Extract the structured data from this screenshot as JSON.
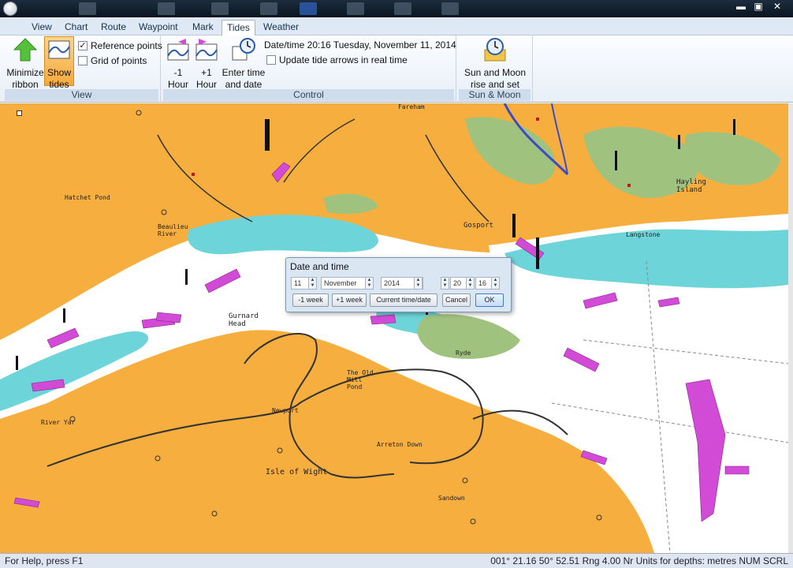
{
  "window": {
    "title": ""
  },
  "menu": {
    "tabs": [
      {
        "label": "View"
      },
      {
        "label": "Chart"
      },
      {
        "label": "Route"
      },
      {
        "label": "Waypoint"
      },
      {
        "label": "Mark"
      },
      {
        "label": "Tides"
      },
      {
        "label": "Weather"
      }
    ],
    "active_tab": "Tides"
  },
  "ribbon": {
    "view_group": {
      "label": "View",
      "minimize_label": "Minimize ribbon",
      "show_tides_label": "Show tides",
      "reference_points_label": "Reference points",
      "reference_points_checked": "✓",
      "grid_of_points_label": "Grid of points"
    },
    "control_group": {
      "label": "Control",
      "minus_hour_label": "-1 Hour",
      "plus_hour_label": "+1 Hour",
      "enter_time_label": "Enter time and date",
      "datetime_text": "Date/time 20:16 Tuesday, November 11, 2014",
      "update_arrows_label": "Update tide arrows in real time"
    },
    "sun_moon_group": {
      "label": "Sun & Moon",
      "button_label": "Sun and Moon rise and set times"
    }
  },
  "dialog": {
    "title": "Date and time",
    "day": "11",
    "month": "November",
    "year": "2014",
    "hour": "20",
    "minute": "16",
    "minus_week": "-1 week",
    "plus_week": "+1 week",
    "current_time": "Current time/date",
    "cancel": "Cancel",
    "ok": "OK"
  },
  "map": {
    "labels": {
      "fareham": "Fareham",
      "gosport": "Gosport",
      "gurnard_head": "Gurnard Head",
      "isle_of_wight": "Isle of Wight",
      "hayling_island": "Hayling Island",
      "river_yar": "River Yar",
      "beaulieu_river": "Beaulieu River",
      "hatchet_pond": "Hatchet Pond",
      "langstone": "Langstone",
      "sun_moon": "",
      "ryde": "Ryde",
      "sandown": "Sandown",
      "arreton_down": "Arreton Down",
      "the_old_mill_pond": "The Old Mill Pond",
      "newport": "Newport"
    },
    "colors": {
      "land": "#f6ae3f",
      "shallow": "#6dd5d9",
      "deep": "#ffffff",
      "intertidal": "#9fc27f",
      "tide_arrow": "#d24bd6"
    }
  },
  "status": {
    "help": "For Help, press F1",
    "position": "001° 21.16 50° 52.51 Rng 4.00 Nr Units for depths: metres NUM SCRL"
  }
}
